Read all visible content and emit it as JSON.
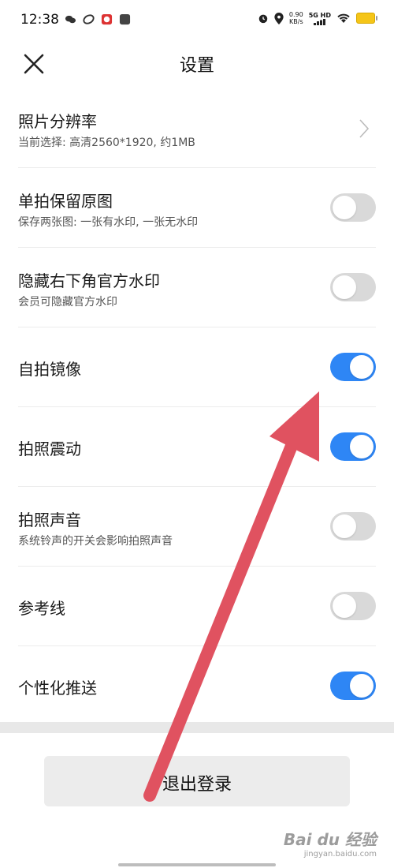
{
  "status_bar": {
    "time": "12:38",
    "speed_value": "0.90",
    "speed_unit": "KB/s",
    "network": "5G HD",
    "icons": [
      "wechat-icon",
      "app-icon",
      "app-badge-icon",
      "square-icon",
      "alarm-icon",
      "location-icon",
      "signal-icon",
      "wifi-icon",
      "battery-icon"
    ]
  },
  "header": {
    "title": "设置",
    "close_icon": "close-icon"
  },
  "settings": [
    {
      "title": "照片分辨率",
      "subtitle": "当前选择: 高清2560*1920, 约1MB",
      "control": "chevron"
    },
    {
      "title": "单拍保留原图",
      "subtitle": "保存两张图: 一张有水印, 一张无水印",
      "control": "toggle",
      "on": false
    },
    {
      "title": "隐藏右下角官方水印",
      "subtitle": "会员可隐藏官方水印",
      "control": "toggle",
      "on": false
    },
    {
      "title": "自拍镜像",
      "subtitle": "",
      "control": "toggle",
      "on": true
    },
    {
      "title": "拍照震动",
      "subtitle": "",
      "control": "toggle",
      "on": true
    },
    {
      "title": "拍照声音",
      "subtitle": "系统铃声的开关会影响拍照声音",
      "control": "toggle",
      "on": false
    },
    {
      "title": "参考线",
      "subtitle": "",
      "control": "toggle",
      "on": false
    },
    {
      "title": "个性化推送",
      "subtitle": "",
      "control": "toggle",
      "on": true
    }
  ],
  "logout_label": "退出登录",
  "watermark": {
    "brand": "Bai du 经验",
    "url": "jingyan.baidu.com"
  },
  "colors": {
    "toggle_on": "#2e86f5",
    "toggle_off": "#d9d9d9",
    "arrow": "#e05260"
  }
}
